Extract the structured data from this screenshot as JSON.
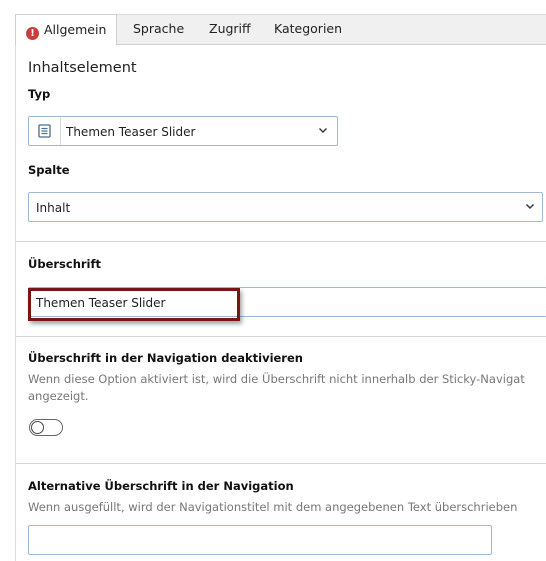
{
  "tabs": [
    {
      "label": "Allgemein",
      "active": true,
      "has_error": true,
      "error_glyph": "!"
    },
    {
      "label": "Sprache",
      "active": false
    },
    {
      "label": "Zugriff",
      "active": false
    },
    {
      "label": "Kategorien",
      "active": false
    }
  ],
  "section_title": "Inhaltselement",
  "typ": {
    "label": "Typ",
    "value": "Themen Teaser Slider",
    "icon": "content-element-icon"
  },
  "spalte": {
    "label": "Spalte",
    "value": "Inhalt"
  },
  "ueberschrift": {
    "label": "Überschrift",
    "value": "Themen Teaser Slider"
  },
  "nav_disable": {
    "label": "Überschrift in der Navigation deaktivieren",
    "desc_line1": "Wenn diese Option aktiviert ist, wird die Überschrift nicht innerhalb der Sticky-Navigat",
    "desc_line2": "angezeigt.",
    "enabled": false
  },
  "alt_nav": {
    "label": "Alternative Überschrift in der Navigation",
    "desc": "Wenn ausgefüllt, wird der Navigationstitel mit dem angegebenen Text überschrieben",
    "value": ""
  },
  "colors": {
    "accent_border": "#9fb8d4",
    "highlight": "#7a1515",
    "error": "#c83c3c"
  }
}
